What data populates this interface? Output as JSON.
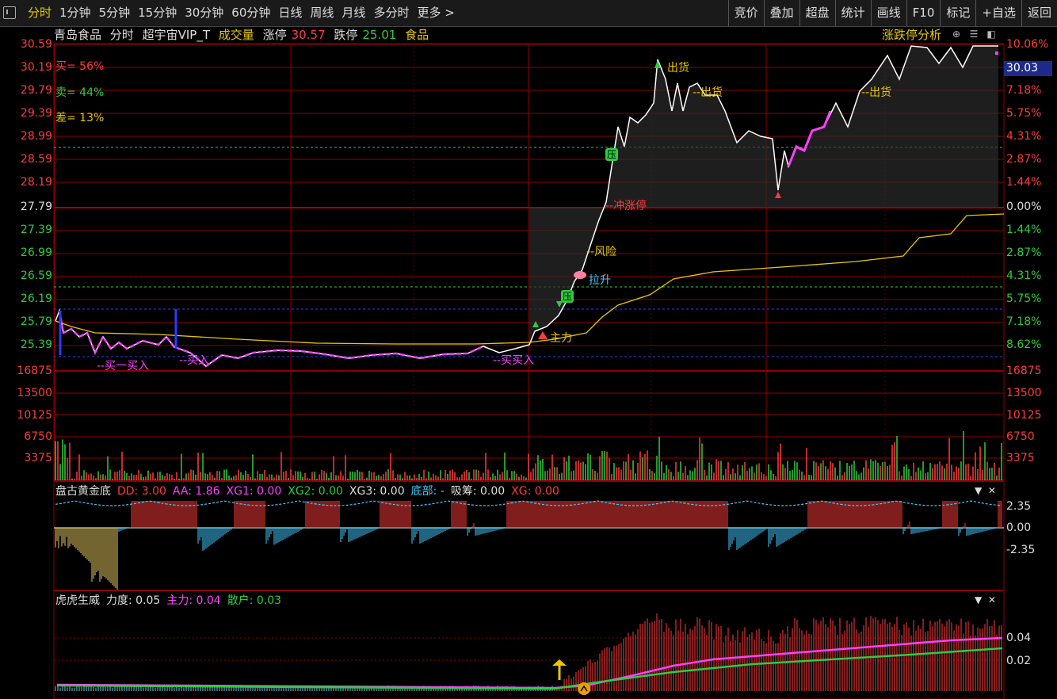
{
  "toolbar": {
    "tabs": [
      "分时",
      "1分钟",
      "5分钟",
      "15分钟",
      "30分钟",
      "60分钟",
      "日线",
      "周线",
      "月线",
      "多分时",
      "更多 >"
    ],
    "right": [
      "竞价",
      "叠加",
      "超盘",
      "统计",
      "画线",
      "F10",
      "标记",
      "+自选",
      "返回"
    ]
  },
  "header": {
    "stock_name": "青岛食品",
    "mode": "分时",
    "formula": "超宇宙VIP_T",
    "volume_label": "成交量",
    "limit_up_label": "涨停",
    "limit_up_value": "30.57",
    "limit_down_label": "跌停",
    "limit_down_value": "25.01",
    "sector": "食品",
    "analysis_link": "涨跌停分析"
  },
  "price_axis": {
    "left": [
      "30.59",
      "30.19",
      "29.79",
      "29.39",
      "28.99",
      "28.59",
      "28.19",
      "27.79",
      "27.39",
      "26.99",
      "26.59",
      "26.19",
      "25.79",
      "25.39"
    ],
    "right": [
      "10.06%",
      "",
      "7.18%",
      "5.75%",
      "4.31%",
      "2.87%",
      "1.44%",
      "0.00%",
      "1.44%",
      "2.87%",
      "4.31%",
      "5.75%",
      "7.18%",
      "8.62%"
    ],
    "current": "30.03"
  },
  "volume_axis": [
    "16875",
    "13500",
    "10125",
    "6750",
    "3375"
  ],
  "stats": {
    "buy": "买= 56%",
    "sell": "卖= 44%",
    "diff": "差= 13%"
  },
  "annotations": {
    "buy1": "--买一买入",
    "buy2": "--买入",
    "buy3": "--买买入",
    "zhuli": "主力",
    "lasheng": "拉升",
    "risk": "--风险",
    "chongzhangting": "--冲涨停",
    "ya": "压",
    "chuhuo1": "出货",
    "chuhuo2": "--出货",
    "chuhuo3": "--出货"
  },
  "indicator1": {
    "name": "盘古黄金底",
    "dd": "DD: 3.00",
    "aa": "AA: 1.86",
    "xg1": "XG1: 0.00",
    "xg2": "XG2: 0.00",
    "xg3": "XG3: 0.00",
    "bottom": "底部: -",
    "absorb": "吸筹: 0.00",
    "xg": "XG: 0.00",
    "axis": [
      "2.35",
      "0.00",
      "-2.35"
    ]
  },
  "indicator2": {
    "name": "虎虎生威",
    "force": "力度: 0.05",
    "main": "主力: 0.04",
    "retail": "散户: 0.03",
    "axis": [
      "0.04",
      "0.02"
    ]
  },
  "colors": {
    "up": "#ff3c3c",
    "down": "#2ecc40",
    "price": "#ffffff",
    "avg": "#e8c800",
    "grid": "#8b0000"
  }
}
